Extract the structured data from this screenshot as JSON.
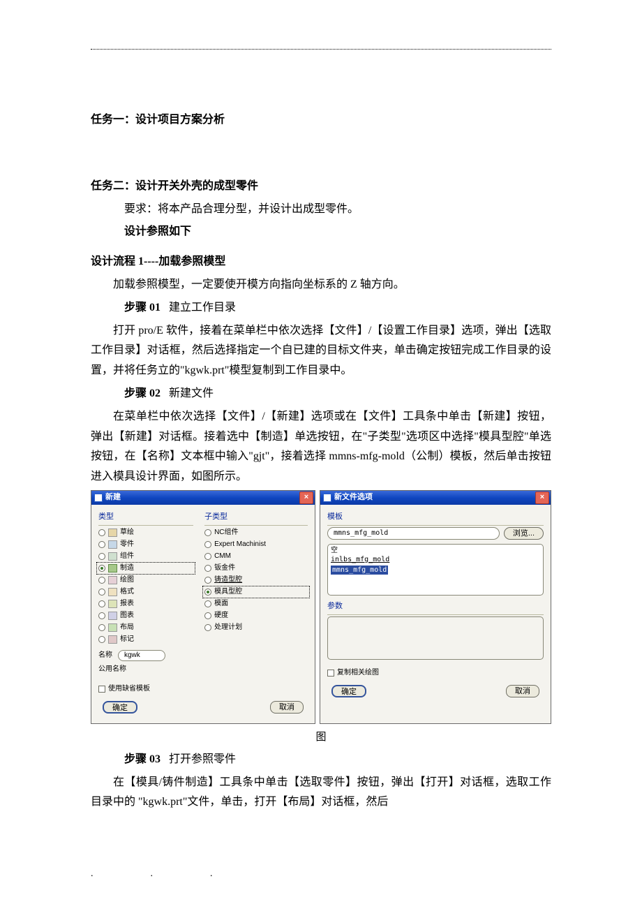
{
  "tasks": {
    "task1_title": "任务一：设计项目方案分析",
    "task2_title": "任务二：设计开关外壳的成型零件",
    "task2_req": "要求：将本产品合理分型，并设计出成型零件。",
    "task2_refheading": "设计参照如下"
  },
  "flow": {
    "flow1_title": "设计流程 1----加载参照模型",
    "flow1_intro": "加载参照模型，一定要使开模方向指向坐标系的 Z 轴方向。",
    "step01_label": "步骤 01",
    "step01_title": "建立工作目录",
    "step01_body": "打开 pro/E 软件，接着在菜单栏中依次选择【文件】/【设置工作目录】选项，弹出【选取工作目录】对话框，然后选择指定一个自已建的目标文件夹，单击确定按钮完成工作目录的设置，并将任务立的\"kgwk.prt\"模型复制到工作目录中。",
    "step02_label": "步骤 02",
    "step02_title": "新建文件",
    "step02_body": "在菜单栏中依次选择【文件】/【新建】选项或在【文件】工具条中单击【新建】按钮，弹出【新建】对话框。接着选中【制造】单选按钮，在\"子类型\"选项区中选择\"模具型腔\"单选按钮，在【名称】文本框中输入\"gjt\"，接着选择 mmns-mfg-mold（公制）模板，然后单击按钮进入模具设计界面，如图所示。",
    "fig_caption": "图",
    "step03_label": "步骤 03",
    "step03_title": "打开参照零件",
    "step03_body": "在【模具/铸件制造】工具条中单击【选取零件】按钮，弹出【打开】对话框，选取工作目录中的 \"kgwk.prt\"文件，单击，打开【布局】对话框，然后"
  },
  "dialog1": {
    "title": "新建",
    "group_type": "类型",
    "group_subtype": "子类型",
    "types": [
      "草绘",
      "零件",
      "组件",
      "制造",
      "绘图",
      "格式",
      "报表",
      "图表",
      "布局",
      "标记"
    ],
    "subtypes": [
      "NC组件",
      "Expert Machinist",
      "CMM",
      "钣金件",
      "铸造型腔",
      "模具型腔",
      "模面",
      "硬度",
      "处理计划"
    ],
    "name_label": "名称",
    "name_value": "kgwk",
    "public_label": "公用名称",
    "use_default_tpl": "使用缺省模板",
    "ok": "确定",
    "cancel": "取消"
  },
  "dialog2": {
    "title": "新文件选项",
    "tpl_label": "模板",
    "tpl_value": "mmns_mfg_mold",
    "browse": "浏览...",
    "list": [
      "空",
      "inlbs_mfg_mold",
      "mmns_mfg_mold"
    ],
    "params_label": "参数",
    "copy_chk": "复制相关绘图",
    "ok": "确定",
    "cancel": "取消"
  }
}
